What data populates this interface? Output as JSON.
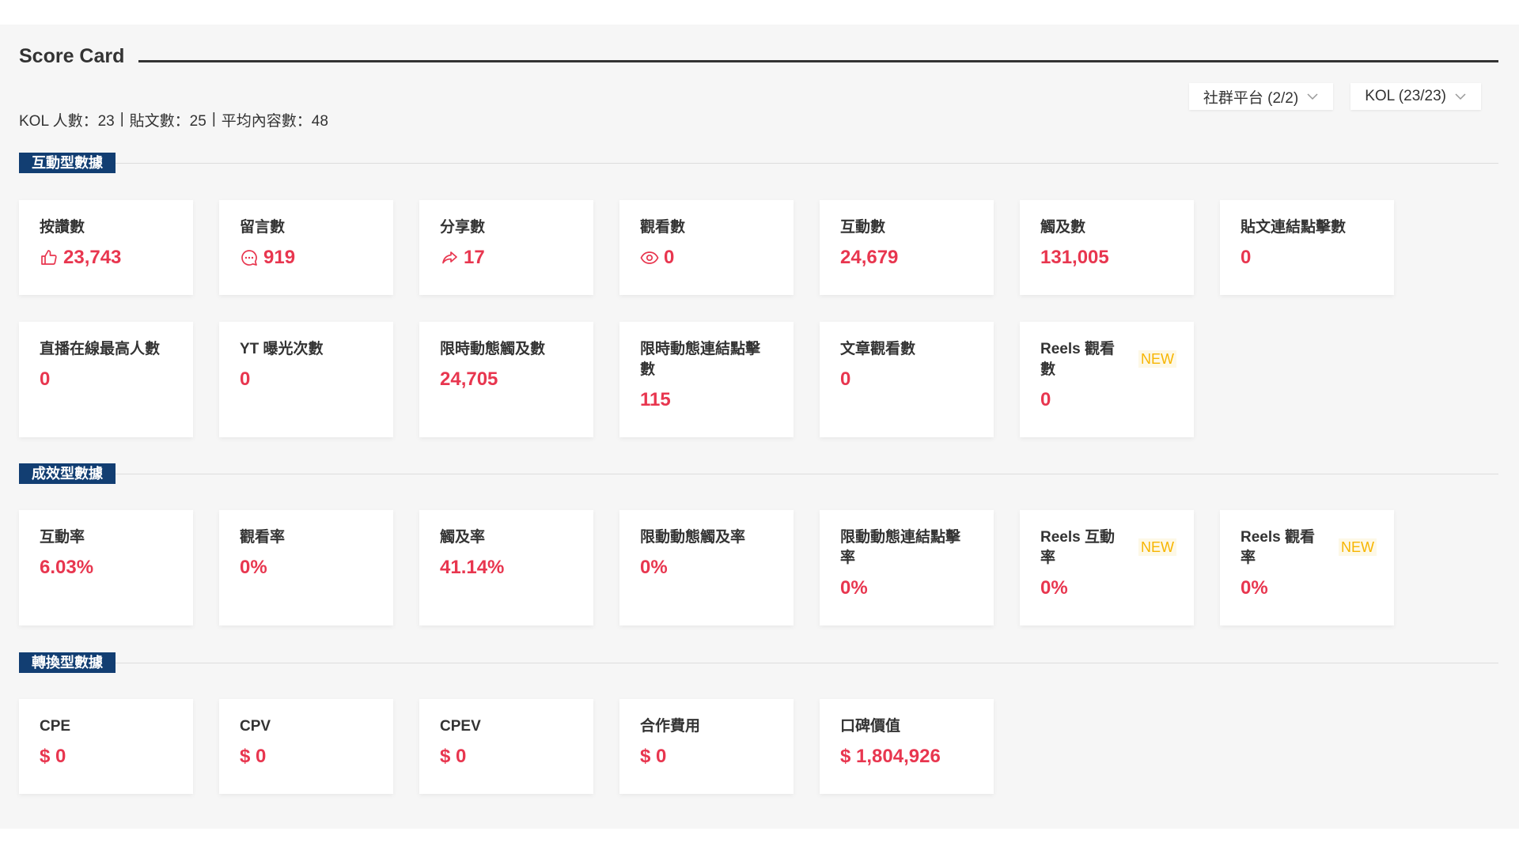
{
  "header": {
    "title": "Score Card"
  },
  "summary": {
    "kol_count": "KOL 人數：23",
    "post_count": "貼文數：25",
    "avg_content": "平均內容數：48",
    "separator": "|"
  },
  "filters": {
    "platform": "社群平台 (2/2)",
    "kol": "KOL (23/23)"
  },
  "sections": {
    "interaction": {
      "title": "互動型數據",
      "cards": [
        {
          "label": "按讚數",
          "value": "23,743",
          "icon": "thumbs-up-icon"
        },
        {
          "label": "留言數",
          "value": "919",
          "icon": "comment-icon"
        },
        {
          "label": "分享數",
          "value": "17",
          "icon": "share-icon"
        },
        {
          "label": "觀看數",
          "value": "0",
          "icon": "eye-icon"
        },
        {
          "label": "互動數",
          "value": "24,679"
        },
        {
          "label": "觸及數",
          "value": "131,005"
        },
        {
          "label": "貼文連結點擊數",
          "value": "0"
        },
        {
          "label": "直播在線最高人數",
          "value": "0"
        },
        {
          "label": "YT 曝光次數",
          "value": "0"
        },
        {
          "label": "限時動態觸及數",
          "value": "24,705"
        },
        {
          "label": "限時動態連結點擊數",
          "value": "115"
        },
        {
          "label": "文章觀看數",
          "value": "0"
        },
        {
          "label": "Reels 觀看數",
          "value": "0",
          "badge": "NEW"
        }
      ]
    },
    "performance": {
      "title": "成效型數據",
      "cards": [
        {
          "label": "互動率",
          "value": "6.03%"
        },
        {
          "label": "觀看率",
          "value": "0%"
        },
        {
          "label": "觸及率",
          "value": "41.14%"
        },
        {
          "label": "限動動態觸及率",
          "value": "0%"
        },
        {
          "label": "限動動態連結點擊率",
          "value": "0%"
        },
        {
          "label": "Reels 互動率",
          "value": "0%",
          "badge": "NEW"
        },
        {
          "label": "Reels 觀看率",
          "value": "0%",
          "badge": "NEW"
        }
      ]
    },
    "conversion": {
      "title": "轉換型數據",
      "cards": [
        {
          "label": "CPE",
          "value": "$ 0"
        },
        {
          "label": "CPV",
          "value": "$ 0"
        },
        {
          "label": "CPEV",
          "value": "$ 0"
        },
        {
          "label": "合作費用",
          "value": "$ 0"
        },
        {
          "label": "口碑價值",
          "value": "$ 1,804,926"
        }
      ]
    }
  },
  "colors": {
    "accent_red": "#e8364f",
    "section_navy": "#123e72",
    "new_badge": "#f7b500"
  }
}
